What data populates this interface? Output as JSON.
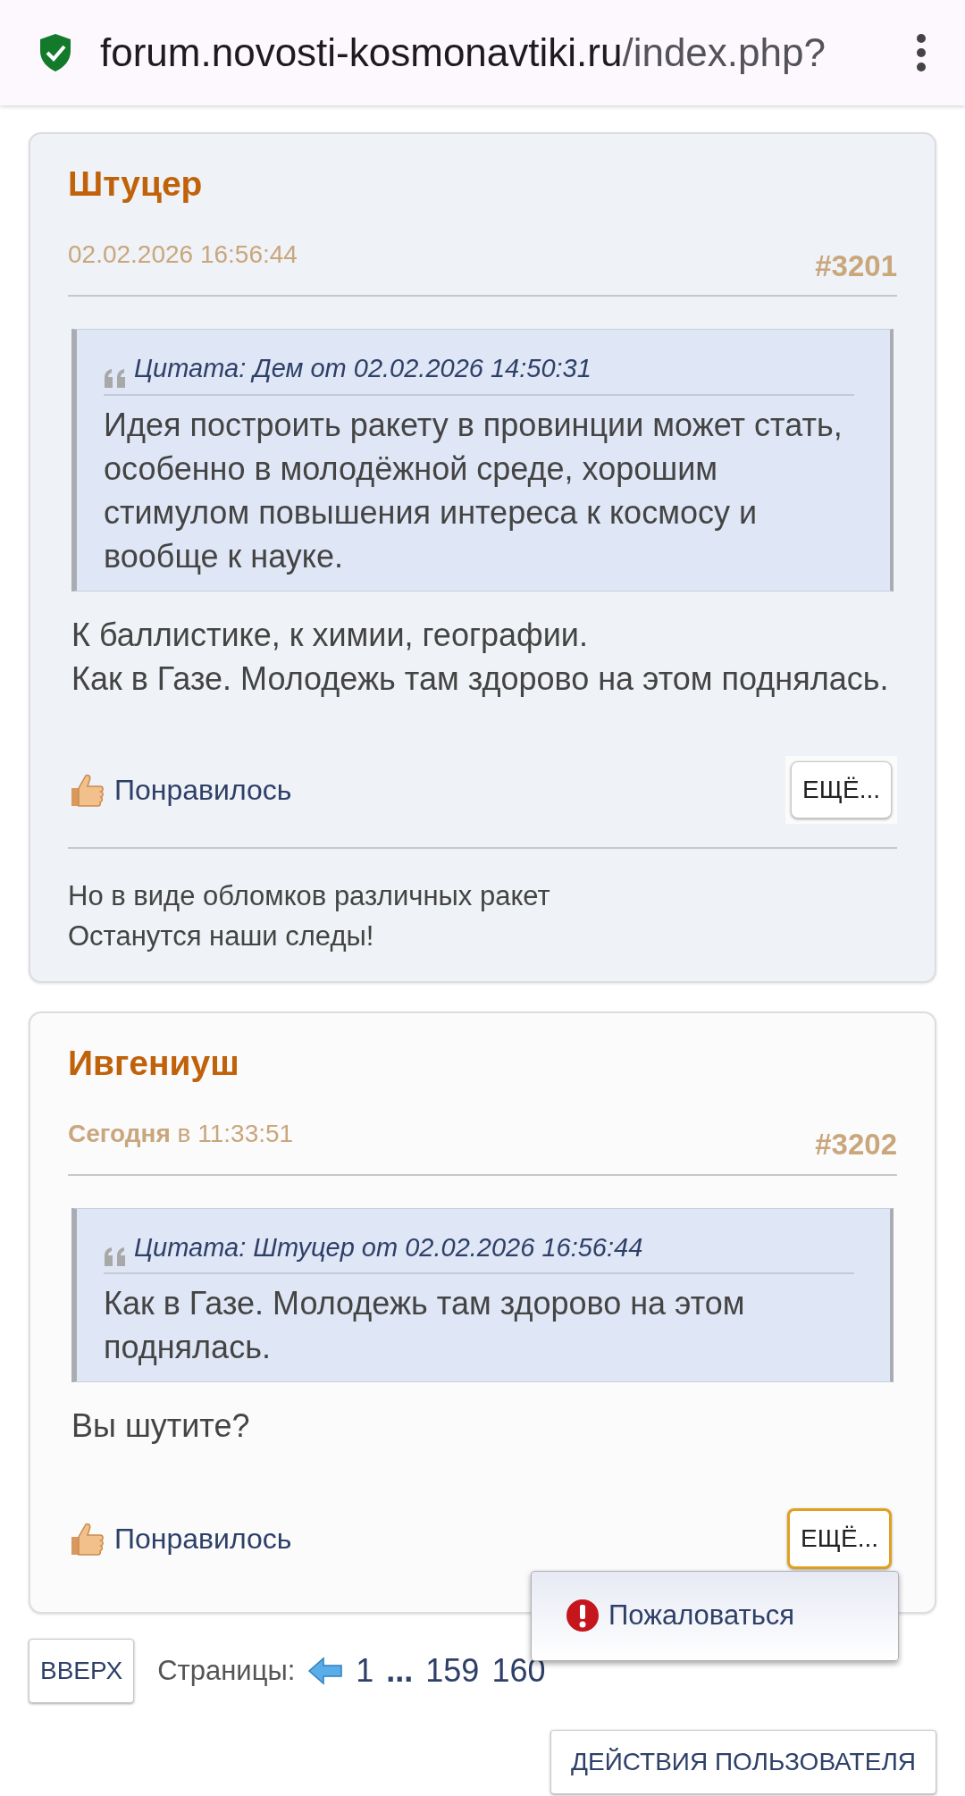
{
  "browser": {
    "url_host": "forum.novosti-kosmonavtiki.ru",
    "url_path": "/index.php?"
  },
  "posts": [
    {
      "username": "Штуцер",
      "date": "02.02.2026 16:56:44",
      "number": "#3201",
      "quote_header": "Цитата: Дем от 02.02.2026 14:50:31",
      "quote_text": "Идея построить ракету в провинции может стать, особенно в молодёжной среде, хорошим стимулом повышения интереса к космосу и вообще к науке.",
      "body": [
        "К баллистике, к химии, географии.",
        "Как в Газе. Молодежь там здорово на этом поднялась."
      ],
      "like": "Понравилось",
      "more": {
        "label": "ЕЩЁ...",
        "focused": false
      },
      "signature": [
        "Но в виде обломков различных ракет",
        "Останутся наши следы!"
      ]
    },
    {
      "username": "Ивгениуш",
      "date": "**Сегодня** в 11:33:51",
      "number": "#3202",
      "quote_header": "Цитата: Штуцер от 02.02.2026 16:56:44",
      "quote_text": "Как в Газе. Молодежь там здорово на этом поднялась.",
      "body": [
        "Вы шутите?"
      ],
      "like": "Понравилось",
      "more": {
        "label": "ЕЩЁ...",
        "focused": true
      }
    }
  ],
  "menu": {
    "items": [
      {
        "label": "Пожаловаться"
      }
    ]
  },
  "footer": {
    "top_button": "ВВЕРХ",
    "pages_label": "Страницы:",
    "pages": [
      {
        "label": "1",
        "kind": "link",
        "selected": false
      },
      {
        "label": "...",
        "kind": "gap",
        "selected": false
      },
      {
        "label": "159",
        "kind": "link",
        "selected": false
      },
      {
        "label": "160",
        "kind": "link",
        "selected": false
      }
    ],
    "actions_button": "ДЕЙСТВИЯ ПОЛЬЗОВАТЕЛЯ"
  }
}
